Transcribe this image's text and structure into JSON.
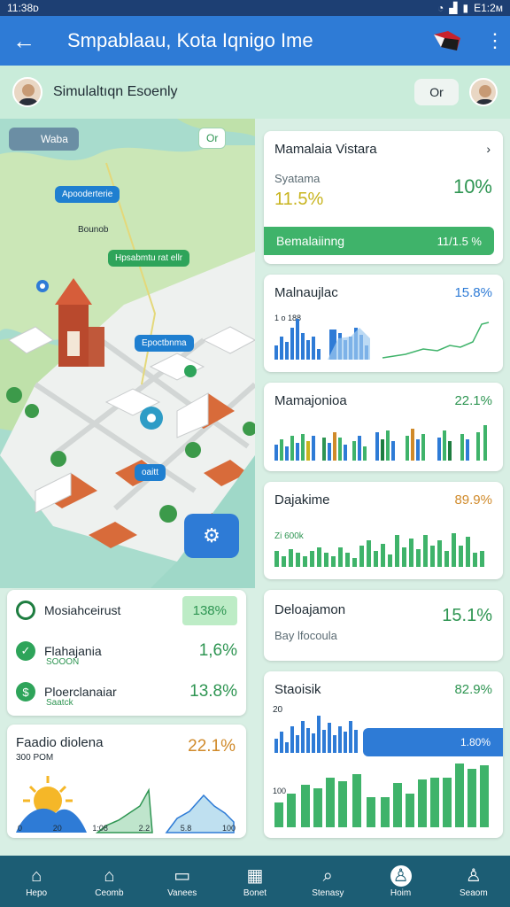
{
  "status": {
    "time": "11:38ᴅ",
    "right": "E1:2ᴍ"
  },
  "appbar": {
    "title": "Smpablaau, Kota Iqnigo Ime"
  },
  "user": {
    "name": "Simulaltıqn Esoenly",
    "pill": "Or"
  },
  "map": {
    "layer_chip": "Waba",
    "toggle": "Or",
    "labels": [
      "Apooderterie",
      "Bounob",
      "Hpsabmtu rat ellr",
      "Epoctbnma",
      "oaitt"
    ]
  },
  "left_cards": {
    "stats": [
      {
        "label": "Mosiahceirust",
        "sub": "",
        "value": "138%",
        "icon": "target-icon"
      },
      {
        "label": "Flahajania",
        "sub": "SOOON",
        "value": "1,6%",
        "icon": "check-icon"
      },
      {
        "label": "Ploerclanaiar",
        "sub": "Saatck",
        "value": "13.8%",
        "icon": "dollar-icon"
      }
    ],
    "chart_card": {
      "title": "Faadio diolena",
      "sub": "300 POM",
      "value": "22.1%",
      "ticks": [
        "0",
        "20",
        "1:08",
        "2.2",
        "5.8",
        "100"
      ]
    }
  },
  "right_cards": [
    {
      "title": "Mamalaia Vistara",
      "value": "",
      "subtitle": "Syatama",
      "big": "11.5%",
      "value2": "10%",
      "bar_label": "Bemalaiinng",
      "bar_value": "11/1.5 %"
    },
    {
      "title": "Malnaujlac",
      "value": "15.8%",
      "note": "1 ᴏ 188"
    },
    {
      "title": "Mamajonioa",
      "value": "22.1%"
    },
    {
      "title": "Dajakime",
      "value": "89.9%",
      "note": "Zi 600k"
    },
    {
      "title": "Deloajamon",
      "value": "15.1%",
      "subtitle": "Bay lfocoula"
    },
    {
      "title": "Staoisik",
      "value": "82.9%",
      "tick_top": "20",
      "tick_bottom": "100",
      "progress_label": "1.80%"
    }
  ],
  "nav": [
    {
      "label": "Hepo",
      "icon": "home-icon"
    },
    {
      "label": "Ceomb",
      "icon": "home-icon"
    },
    {
      "label": "Vanees",
      "icon": "chat-icon"
    },
    {
      "label": "Bonet",
      "icon": "calendar-icon"
    },
    {
      "label": "Stenasy",
      "icon": "search-icon"
    },
    {
      "label": "Hoim",
      "icon": "person-icon"
    },
    {
      "label": "Seaom",
      "icon": "person-icon"
    }
  ],
  "colors": {
    "appbar": "#2e7bd6",
    "accent_green": "#2e9552",
    "nav": "#1c5d74",
    "warn": "#d08a2a"
  }
}
